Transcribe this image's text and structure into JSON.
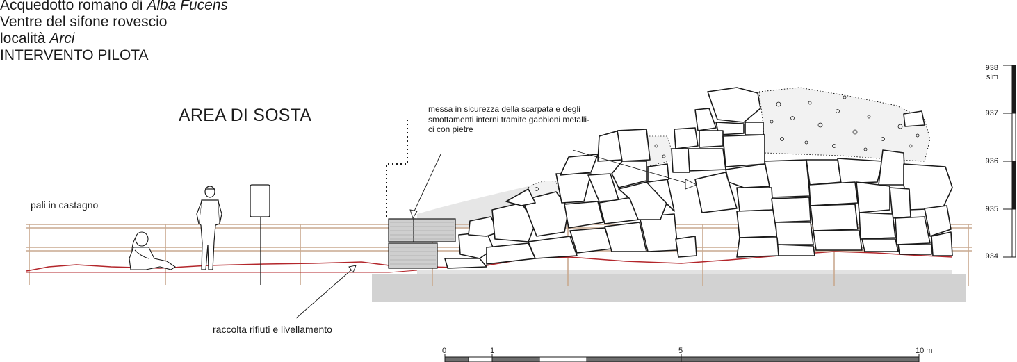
{
  "title": {
    "line1_prefix": "Acquedotto romano di ",
    "line1_italic": "Alba Fucens",
    "line2": "Ventre del sifone rovescio",
    "line3_prefix": "località ",
    "line3_italic": "Arci",
    "line4": "INTERVENTO PILOTA"
  },
  "area_label": "AREA DI SOSTA",
  "annotations": {
    "pali": "pali in castagno",
    "raccolta": "raccolta rifiuti e livellamento",
    "messa_1": "messa in sicurezza della scarpata e degli",
    "messa_2": "smottamenti interni tramite gabbioni metalli-",
    "messa_3": "ci con pietre"
  },
  "elevation_scale": {
    "unit": "slm",
    "ticks": [
      "938",
      "937",
      "936",
      "935",
      "934"
    ]
  },
  "scale_bar": {
    "labels": [
      "0",
      "1",
      "5",
      "10 m"
    ]
  },
  "colors": {
    "ground_line": "#b3262b",
    "railing": "#c9a98f",
    "platform": "#d2d2d2",
    "stone_stroke": "#1a1a1a"
  }
}
